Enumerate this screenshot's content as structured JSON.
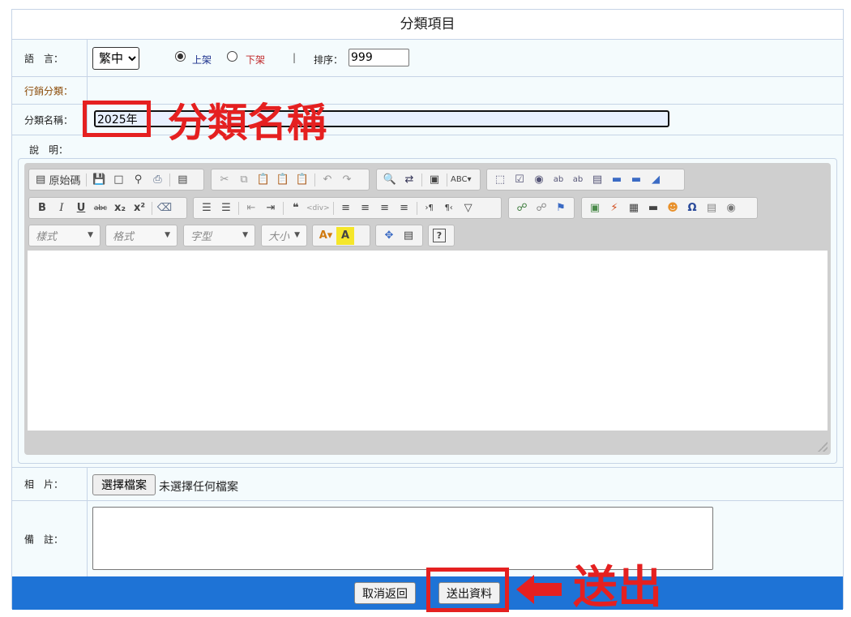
{
  "title": "分類項目",
  "language": {
    "label": "語　言：",
    "selected": "繁中",
    "radio_on_label": "上架",
    "radio_off_label": "下架",
    "divider": "|",
    "sort_label": "排序：",
    "sort_value": "999"
  },
  "marketing": {
    "label": "行銷分類："
  },
  "category_name": {
    "label": "分類名稱：",
    "value": "2025年"
  },
  "description": {
    "label": "說　明："
  },
  "editor": {
    "source_label": "原始碼",
    "style_combo": "樣式",
    "format_combo": "格式",
    "font_combo": "字型",
    "size_combo": "大小"
  },
  "photo": {
    "label": "相　片：",
    "choose_button": "選擇檔案",
    "no_file_text": "未選擇任何檔案"
  },
  "memo": {
    "label": "備　註："
  },
  "actions": {
    "cancel_label": "取消返回",
    "submit_label": "送出資料"
  },
  "annotations": {
    "category_name_callout": "分類名稱",
    "submit_callout": "送出",
    "color": "#e52020"
  },
  "colors": {
    "bottom_bar": "#1e73d6",
    "row_bg": "#f4fbfd",
    "border": "#c6d4e6"
  }
}
